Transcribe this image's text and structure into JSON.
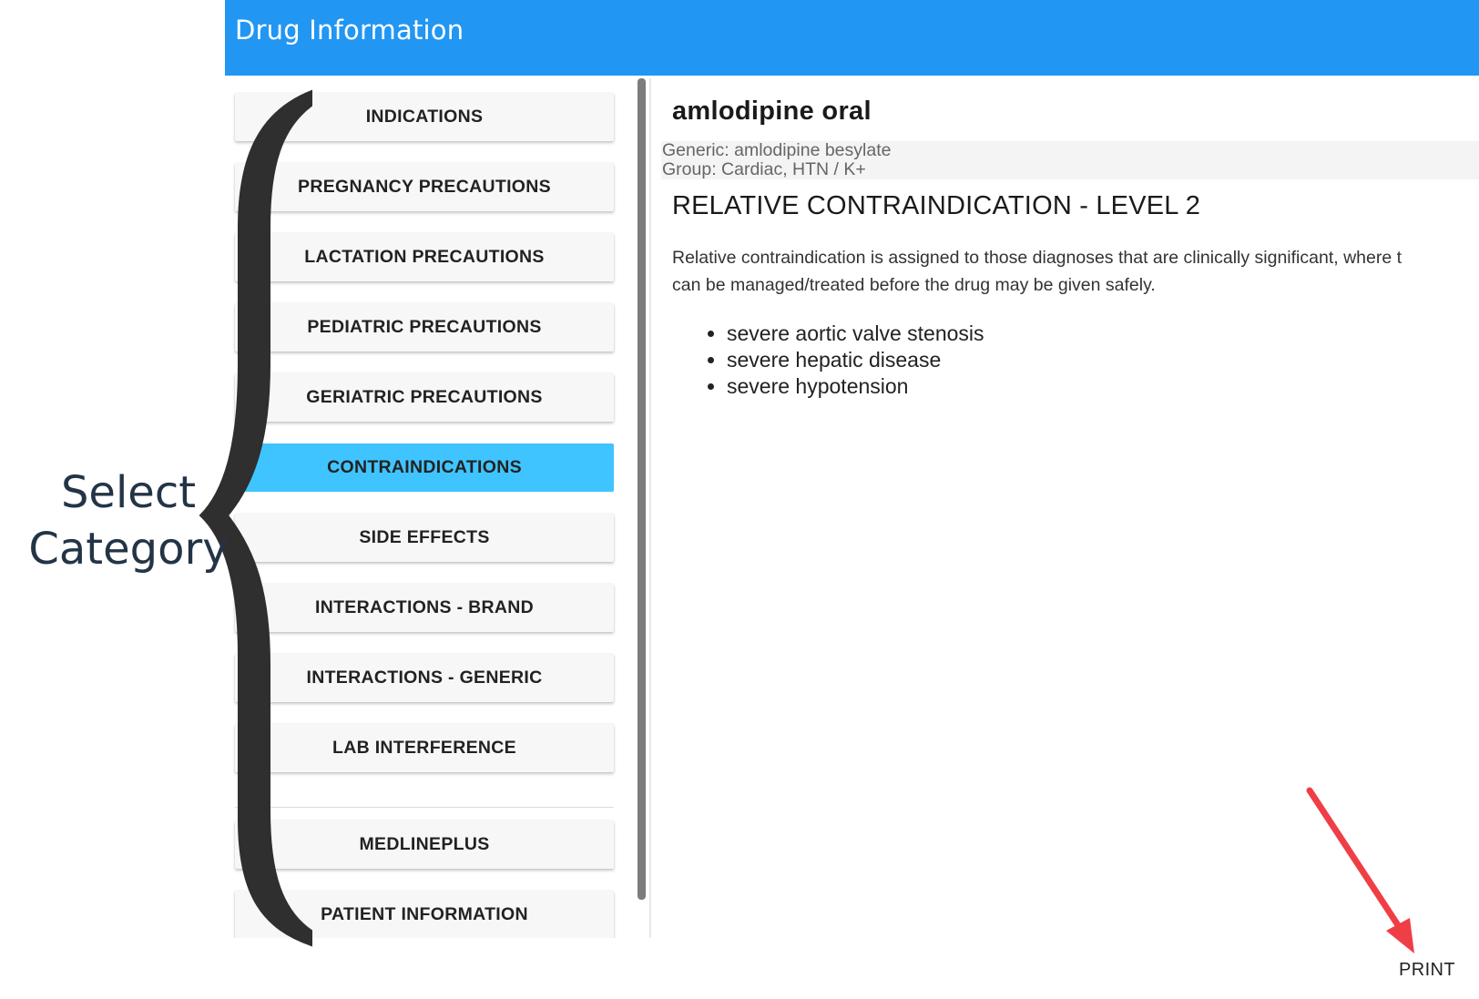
{
  "header": {
    "title": "Drug Information",
    "color": "#2196f3"
  },
  "sidebar": {
    "items": [
      {
        "label": "INDICATIONS",
        "active": false
      },
      {
        "label": "PREGNANCY PRECAUTIONS",
        "active": false
      },
      {
        "label": "LACTATION PRECAUTIONS",
        "active": false
      },
      {
        "label": "PEDIATRIC PRECAUTIONS",
        "active": false
      },
      {
        "label": "GERIATRIC PRECAUTIONS",
        "active": false
      },
      {
        "label": "CONTRAINDICATIONS",
        "active": true
      },
      {
        "label": "SIDE EFFECTS",
        "active": false
      },
      {
        "label": "INTERACTIONS - BRAND",
        "active": false
      },
      {
        "label": "INTERACTIONS - GENERIC",
        "active": false
      },
      {
        "label": "LAB INTERFERENCE",
        "active": false
      }
    ],
    "extra_items": [
      {
        "label": "MEDLINEPLUS"
      },
      {
        "label": "PATIENT INFORMATION"
      }
    ],
    "active_color": "#40c4ff"
  },
  "drug": {
    "name": "amlodipine oral",
    "generic": "Generic: amlodipine besylate",
    "group": "Group: Cardiac, HTN / K+"
  },
  "content": {
    "heading": "RELATIVE CONTRAINDICATION - LEVEL 2",
    "description_line1": "Relative contraindication is assigned to those diagnoses that are clinically significant, where t",
    "description_line2": "can be managed/treated before the drug may be given safely.",
    "items": [
      "severe aortic valve stenosis",
      "severe hepatic disease",
      "severe hypotension"
    ]
  },
  "print_label": "PRINT",
  "annotations": {
    "select_line1": "Select",
    "select_line2": "Category",
    "arrow_color": "#f03e47"
  }
}
